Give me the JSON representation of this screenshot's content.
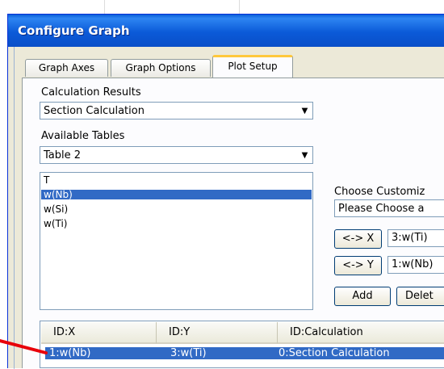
{
  "window": {
    "title": "Configure Graph"
  },
  "tabs": [
    {
      "label": "Graph Axes"
    },
    {
      "label": "Graph Options"
    },
    {
      "label": "Plot Setup",
      "active": true
    }
  ],
  "calc_results": {
    "label": "Calculation Results",
    "value": "Section Calculation"
  },
  "available_tables": {
    "label": "Available Tables",
    "value": "Table 2"
  },
  "columns_list": {
    "items": [
      "T",
      "w(Nb)",
      "w(Si)",
      "w(Ti)"
    ],
    "selected_index": 1
  },
  "customize": {
    "label": "Choose Customiz",
    "select_value": "Please Choose a",
    "swap_x_label": "<-> X",
    "x_value": "3:w(Ti)",
    "swap_y_label": "<-> Y",
    "y_value": "1:w(Nb)",
    "add_label": "Add",
    "delete_label": "Delet"
  },
  "plot_table": {
    "headers": [
      "ID:X",
      "ID:Y",
      "ID:Calculation"
    ],
    "rows": [
      {
        "x": "1:w(Nb)",
        "y": "3:w(Ti)",
        "calc": "0:Section Calculation",
        "selected": true
      }
    ]
  },
  "icons": {
    "dropdown": "chevron-down-icon"
  },
  "colors": {
    "title_bar": "#0a5fd8",
    "selection": "#316ac5",
    "tab_highlight": "#ffc83c",
    "annotation": "#e8000a"
  }
}
